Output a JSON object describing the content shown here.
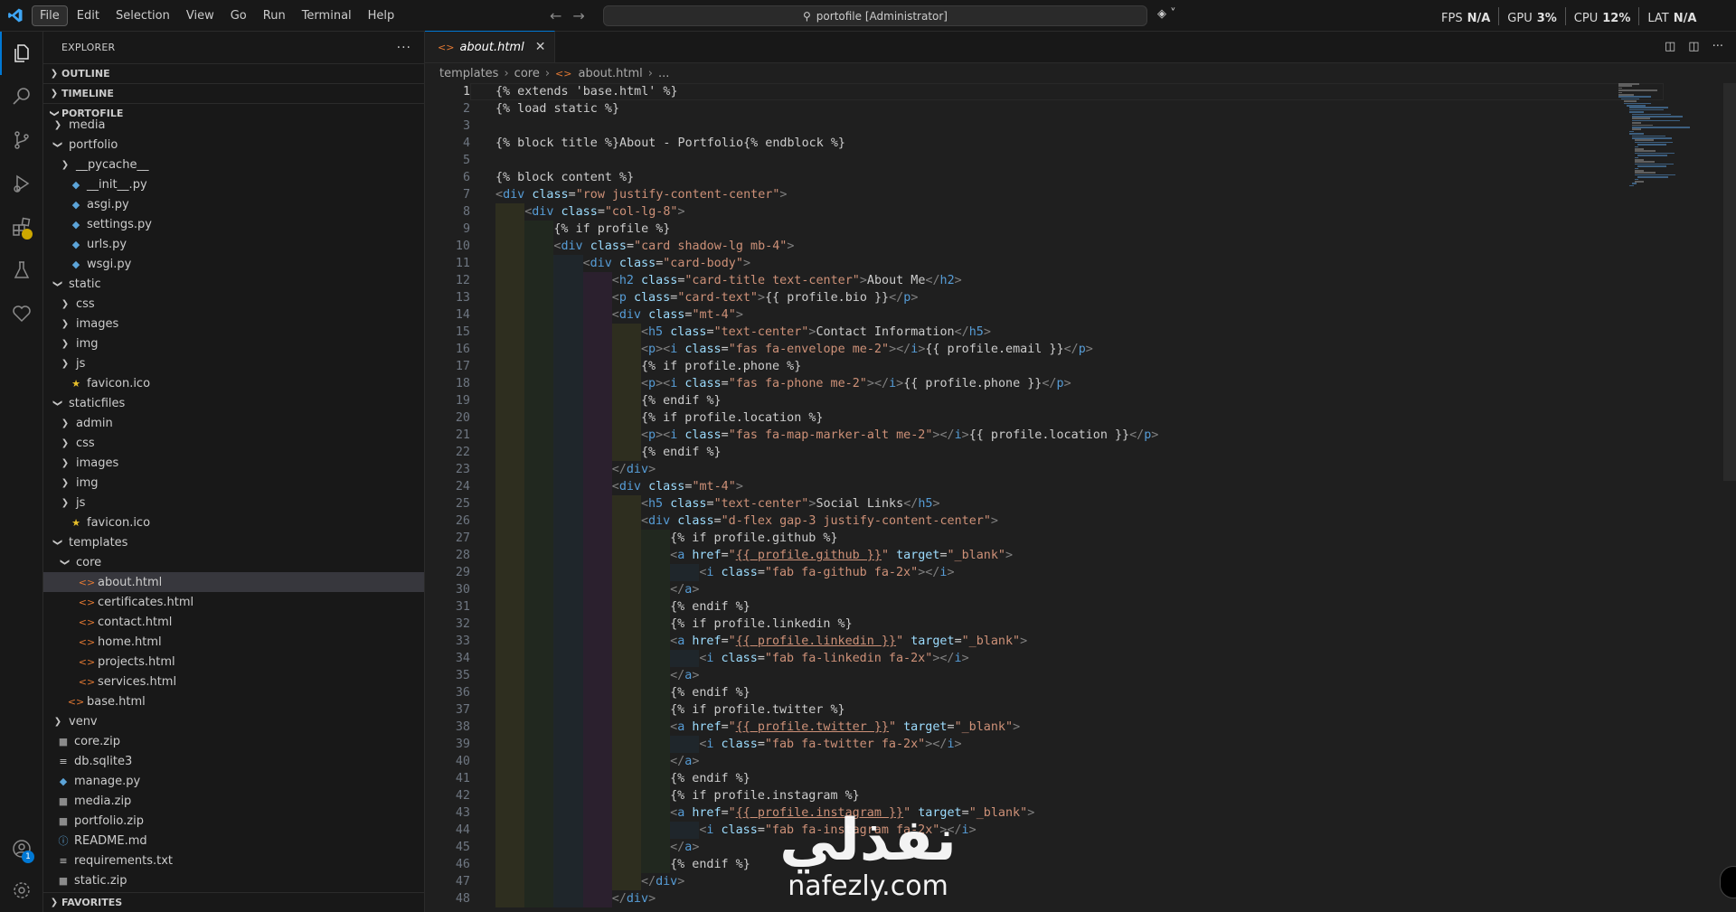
{
  "menu": [
    "File",
    "Edit",
    "Selection",
    "View",
    "Go",
    "Run",
    "Terminal",
    "Help"
  ],
  "command_center": {
    "text": "portofile [Administrator]"
  },
  "stats": [
    {
      "label": "FPS",
      "value": "N/A"
    },
    {
      "label": "GPU",
      "value": "3%"
    },
    {
      "label": "CPU",
      "value": "12%"
    },
    {
      "label": "LAT",
      "value": "N/A"
    }
  ],
  "explorer": {
    "title": "EXPLORER",
    "sections": {
      "outline": "OUTLINE",
      "timeline": "TIMELINE",
      "project": "PORTOFILE",
      "favorites": "FAVORITES"
    },
    "tree": [
      {
        "label": "media",
        "depth": 1,
        "kind": "folder",
        "open": false
      },
      {
        "label": "portfolio",
        "depth": 1,
        "kind": "folder",
        "open": true
      },
      {
        "label": "__pycache__",
        "depth": 2,
        "kind": "folder",
        "open": false
      },
      {
        "label": "__init__.py",
        "depth": 2,
        "kind": "py"
      },
      {
        "label": "asgi.py",
        "depth": 2,
        "kind": "py"
      },
      {
        "label": "settings.py",
        "depth": 2,
        "kind": "py"
      },
      {
        "label": "urls.py",
        "depth": 2,
        "kind": "py"
      },
      {
        "label": "wsgi.py",
        "depth": 2,
        "kind": "py"
      },
      {
        "label": "static",
        "depth": 1,
        "kind": "folder",
        "open": true
      },
      {
        "label": "css",
        "depth": 2,
        "kind": "folder",
        "open": false
      },
      {
        "label": "images",
        "depth": 2,
        "kind": "folder",
        "open": false
      },
      {
        "label": "img",
        "depth": 2,
        "kind": "folder",
        "open": false
      },
      {
        "label": "js",
        "depth": 2,
        "kind": "folder",
        "open": false
      },
      {
        "label": "favicon.ico",
        "depth": 2,
        "kind": "star"
      },
      {
        "label": "staticfiles",
        "depth": 1,
        "kind": "folder",
        "open": true
      },
      {
        "label": "admin",
        "depth": 2,
        "kind": "folder",
        "open": false
      },
      {
        "label": "css",
        "depth": 2,
        "kind": "folder",
        "open": false
      },
      {
        "label": "images",
        "depth": 2,
        "kind": "folder",
        "open": false
      },
      {
        "label": "img",
        "depth": 2,
        "kind": "folder",
        "open": false
      },
      {
        "label": "js",
        "depth": 2,
        "kind": "folder",
        "open": false
      },
      {
        "label": "favicon.ico",
        "depth": 2,
        "kind": "star"
      },
      {
        "label": "templates",
        "depth": 1,
        "kind": "folder",
        "open": true
      },
      {
        "label": "core",
        "depth": 2,
        "kind": "folder",
        "open": true
      },
      {
        "label": "about.html",
        "depth": 3,
        "kind": "html",
        "selected": true
      },
      {
        "label": "certificates.html",
        "depth": 3,
        "kind": "html"
      },
      {
        "label": "contact.html",
        "depth": 3,
        "kind": "html"
      },
      {
        "label": "home.html",
        "depth": 3,
        "kind": "html"
      },
      {
        "label": "projects.html",
        "depth": 3,
        "kind": "html"
      },
      {
        "label": "services.html",
        "depth": 3,
        "kind": "html"
      },
      {
        "label": "base.html",
        "depth": 2,
        "kind": "html"
      },
      {
        "label": "venv",
        "depth": 1,
        "kind": "folder",
        "open": false
      },
      {
        "label": "core.zip",
        "depth": 1,
        "kind": "zip"
      },
      {
        "label": "db.sqlite3",
        "depth": 1,
        "kind": "db"
      },
      {
        "label": "manage.py",
        "depth": 1,
        "kind": "py"
      },
      {
        "label": "media.zip",
        "depth": 1,
        "kind": "zip"
      },
      {
        "label": "portfolio.zip",
        "depth": 1,
        "kind": "zip"
      },
      {
        "label": "README.md",
        "depth": 1,
        "kind": "info"
      },
      {
        "label": "requirements.txt",
        "depth": 1,
        "kind": "txt"
      },
      {
        "label": "static.zip",
        "depth": 1,
        "kind": "zip"
      }
    ]
  },
  "tab": {
    "label": "about.html",
    "close_icon": "close-icon"
  },
  "breadcrumb": [
    "templates",
    "core",
    "about.html",
    "..."
  ],
  "editor": {
    "current_line": 1,
    "lines": [
      {
        "n": "1",
        "indent": 0,
        "text": "{% extends 'base.html' %}"
      },
      {
        "n": "2",
        "indent": 0,
        "text": "{% load static %}"
      },
      {
        "n": "3",
        "indent": 0,
        "text": ""
      },
      {
        "n": "4",
        "indent": 0,
        "text": "{% block title %}About - Portfolio{% endblock %}"
      },
      {
        "n": "5",
        "indent": 0,
        "text": ""
      },
      {
        "n": "6",
        "indent": 0,
        "text": "{% block content %}"
      },
      {
        "n": "7",
        "indent": 0,
        "text": "<div class=\"row justify-content-center\">"
      },
      {
        "n": "8",
        "indent": 1,
        "text": "<div class=\"col-lg-8\">"
      },
      {
        "n": "9",
        "indent": 2,
        "text": "{% if profile %}"
      },
      {
        "n": "10",
        "indent": 2,
        "text": "<div class=\"card shadow-lg mb-4\">"
      },
      {
        "n": "11",
        "indent": 3,
        "text": "<div class=\"card-body\">"
      },
      {
        "n": "12",
        "indent": 4,
        "text": "<h2 class=\"card-title text-center\">About Me</h2>"
      },
      {
        "n": "13",
        "indent": 4,
        "text": "<p class=\"card-text\">{{ profile.bio }}</p>"
      },
      {
        "n": "14",
        "indent": 4,
        "text": "<div class=\"mt-4\">"
      },
      {
        "n": "15",
        "indent": 5,
        "text": "<h5 class=\"text-center\">Contact Information</h5>"
      },
      {
        "n": "16",
        "indent": 5,
        "text": "<p><i class=\"fas fa-envelope me-2\"></i>{{ profile.email }}</p>"
      },
      {
        "n": "17",
        "indent": 5,
        "text": "{% if profile.phone %}"
      },
      {
        "n": "18",
        "indent": 5,
        "text": "<p><i class=\"fas fa-phone me-2\"></i>{{ profile.phone }}</p>"
      },
      {
        "n": "19",
        "indent": 5,
        "text": "{% endif %}"
      },
      {
        "n": "20",
        "indent": 5,
        "text": "{% if profile.location %}"
      },
      {
        "n": "21",
        "indent": 5,
        "text": "<p><i class=\"fas fa-map-marker-alt me-2\"></i>{{ profile.location }}</p>"
      },
      {
        "n": "22",
        "indent": 5,
        "text": "{% endif %}"
      },
      {
        "n": "23",
        "indent": 4,
        "text": "</div>"
      },
      {
        "n": "24",
        "indent": 4,
        "text": "<div class=\"mt-4\">"
      },
      {
        "n": "25",
        "indent": 5,
        "text": "<h5 class=\"text-center\">Social Links</h5>"
      },
      {
        "n": "26",
        "indent": 5,
        "text": "<div class=\"d-flex gap-3 justify-content-center\">"
      },
      {
        "n": "27",
        "indent": 6,
        "text": "{% if profile.github %}"
      },
      {
        "n": "28",
        "indent": 6,
        "text": "<a href=\"{{ profile.github }}\" target=\"_blank\">"
      },
      {
        "n": "29",
        "indent": 7,
        "text": "<i class=\"fab fa-github fa-2x\"></i>"
      },
      {
        "n": "30",
        "indent": 6,
        "text": "</a>"
      },
      {
        "n": "31",
        "indent": 6,
        "text": "{% endif %}"
      },
      {
        "n": "32",
        "indent": 6,
        "text": "{% if profile.linkedin %}"
      },
      {
        "n": "33",
        "indent": 6,
        "text": "<a href=\"{{ profile.linkedin }}\" target=\"_blank\">"
      },
      {
        "n": "34",
        "indent": 7,
        "text": "<i class=\"fab fa-linkedin fa-2x\"></i>"
      },
      {
        "n": "35",
        "indent": 6,
        "text": "</a>"
      },
      {
        "n": "36",
        "indent": 6,
        "text": "{% endif %}"
      },
      {
        "n": "37",
        "indent": 6,
        "text": "{% if profile.twitter %}"
      },
      {
        "n": "38",
        "indent": 6,
        "text": "<a href=\"{{ profile.twitter }}\" target=\"_blank\">"
      },
      {
        "n": "39",
        "indent": 7,
        "text": "<i class=\"fab fa-twitter fa-2x\"></i>"
      },
      {
        "n": "40",
        "indent": 6,
        "text": "</a>"
      },
      {
        "n": "41",
        "indent": 6,
        "text": "{% endif %}"
      },
      {
        "n": "42",
        "indent": 6,
        "text": "{% if profile.instagram %}"
      },
      {
        "n": "43",
        "indent": 6,
        "text": "<a href=\"{{ profile.instagram }}\" target=\"_blank\">"
      },
      {
        "n": "44",
        "indent": 7,
        "text": "<i class=\"fab fa-instagram fa-2x\"></i>"
      },
      {
        "n": "45",
        "indent": 6,
        "text": "</a>"
      },
      {
        "n": "46",
        "indent": 6,
        "text": "{% endif %}"
      },
      {
        "n": "47",
        "indent": 5,
        "text": "</div>"
      },
      {
        "n": "48",
        "indent": 4,
        "text": "</div>"
      }
    ]
  },
  "watermark": {
    "arabic": "نفذلي",
    "latin": "nafezly.com"
  },
  "colors": {
    "accent": "#0078d4",
    "tag": "#569cd6",
    "attr": "#9cdcfe",
    "string": "#ce9178"
  }
}
